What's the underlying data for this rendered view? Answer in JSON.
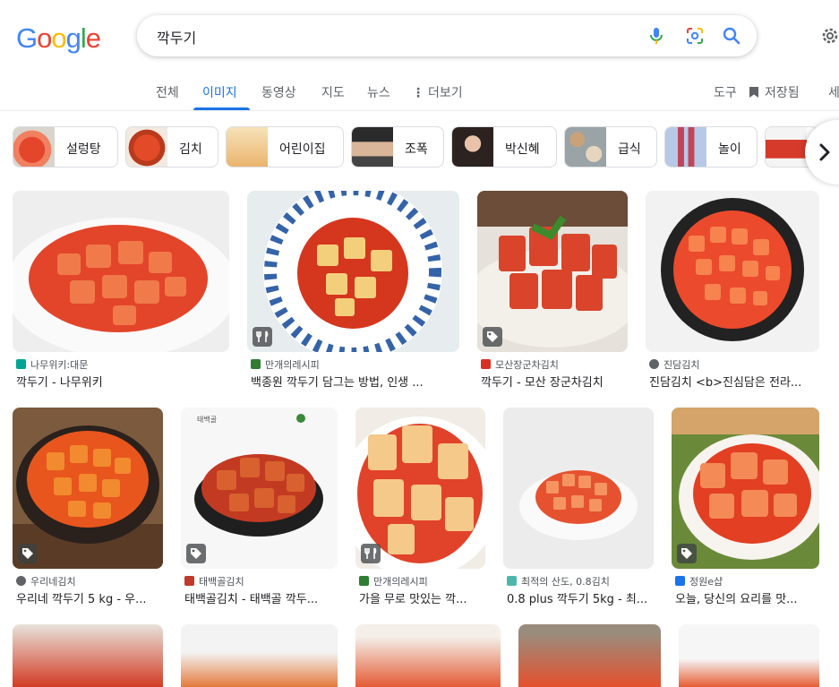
{
  "search": {
    "query": "깍두기"
  },
  "logo": {
    "letters": [
      "G",
      "o",
      "o",
      "g",
      "l",
      "e"
    ],
    "colors": [
      "#4285F4",
      "#EA4335",
      "#FBBC05",
      "#4285F4",
      "#34A853",
      "#EA4335"
    ]
  },
  "tabs": [
    {
      "label": "전체"
    },
    {
      "label": "이미지"
    },
    {
      "label": "동영상"
    },
    {
      "label": "지도"
    },
    {
      "label": "뉴스"
    },
    {
      "label": "더보기"
    }
  ],
  "tools": {
    "tools_label": "도구",
    "saved_label": "저장됨",
    "safe_label": "세"
  },
  "chips": [
    {
      "label": "설렁탕"
    },
    {
      "label": "김치"
    },
    {
      "label": "어린이집"
    },
    {
      "label": "조폭"
    },
    {
      "label": "박신혜"
    },
    {
      "label": "급식"
    },
    {
      "label": "놀이"
    }
  ],
  "results": [
    {
      "source": "나무위키:대문",
      "title": "깍두기 - 나무위키",
      "fav": "#00a495",
      "badge": ""
    },
    {
      "source": "만개의레시피",
      "title": "백종원 깍두기 담그는 방법, 인생 ...",
      "fav": "#2e7d32",
      "badge": "fork-knife-icon"
    },
    {
      "source": "모산장군차김치",
      "title": "깍두기 - 모산 장군차김치",
      "fav": "#d93025",
      "badge": "tag-icon"
    },
    {
      "source": "진담김치",
      "title": "진담김치 <b>진심담은 전라...",
      "fav": "#5f6368",
      "badge": ""
    },
    {
      "source": "우리네김치",
      "title": "우리네 깍두기 5 kg - 우...",
      "fav": "#5f6368",
      "badge": "tag-icon"
    },
    {
      "source": "태백골김치",
      "title": "태백골김치 - 태백골 깍두...",
      "fav": "#c0392b",
      "badge": "tag-icon"
    },
    {
      "source": "만개의레시피",
      "title": "가을 무로 맛있는 깍...",
      "fav": "#2e7d32",
      "badge": "fork-knife-icon"
    },
    {
      "source": "최적의 산도, 0.8김치",
      "title": "0.8 plus 깍두기 5kg - 최...",
      "fav": "#4db6ac",
      "badge": ""
    },
    {
      "source": "정원e샵",
      "title": "오늘, 당신의 요리를 맛...",
      "fav": "#1a73e8",
      "badge": "tag-icon"
    }
  ]
}
